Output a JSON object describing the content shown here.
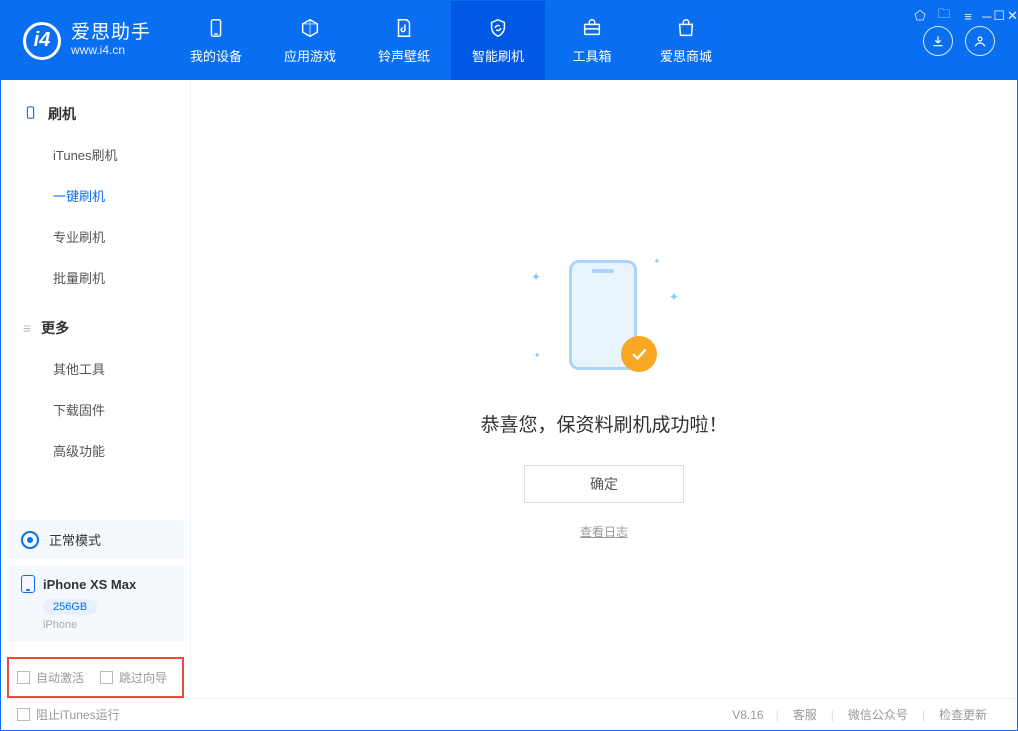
{
  "app": {
    "logo_title": "爱思助手",
    "logo_url": "www.i4.cn"
  },
  "tabs": [
    {
      "label": "我的设备"
    },
    {
      "label": "应用游戏"
    },
    {
      "label": "铃声壁纸"
    },
    {
      "label": "智能刷机"
    },
    {
      "label": "工具箱"
    },
    {
      "label": "爱思商城"
    }
  ],
  "sidebar": {
    "section1_title": "刷机",
    "items1": [
      {
        "label": "iTunes刷机"
      },
      {
        "label": "一键刷机"
      },
      {
        "label": "专业刷机"
      },
      {
        "label": "批量刷机"
      }
    ],
    "section2_title": "更多",
    "items2": [
      {
        "label": "其他工具"
      },
      {
        "label": "下载固件"
      },
      {
        "label": "高级功能"
      }
    ]
  },
  "mode_card": {
    "label": "正常模式"
  },
  "device": {
    "name": "iPhone XS Max",
    "capacity": "256GB",
    "type": "iPhone"
  },
  "options": {
    "auto_activate": "自动激活",
    "skip_guide": "跳过向导"
  },
  "main": {
    "success_text": "恭喜您，保资料刷机成功啦！",
    "ok_label": "确定",
    "view_log": "查看日志"
  },
  "footer": {
    "block_itunes": "阻止iTunes运行",
    "version": "V8.16",
    "links": [
      "客服",
      "微信公众号",
      "检查更新"
    ]
  }
}
